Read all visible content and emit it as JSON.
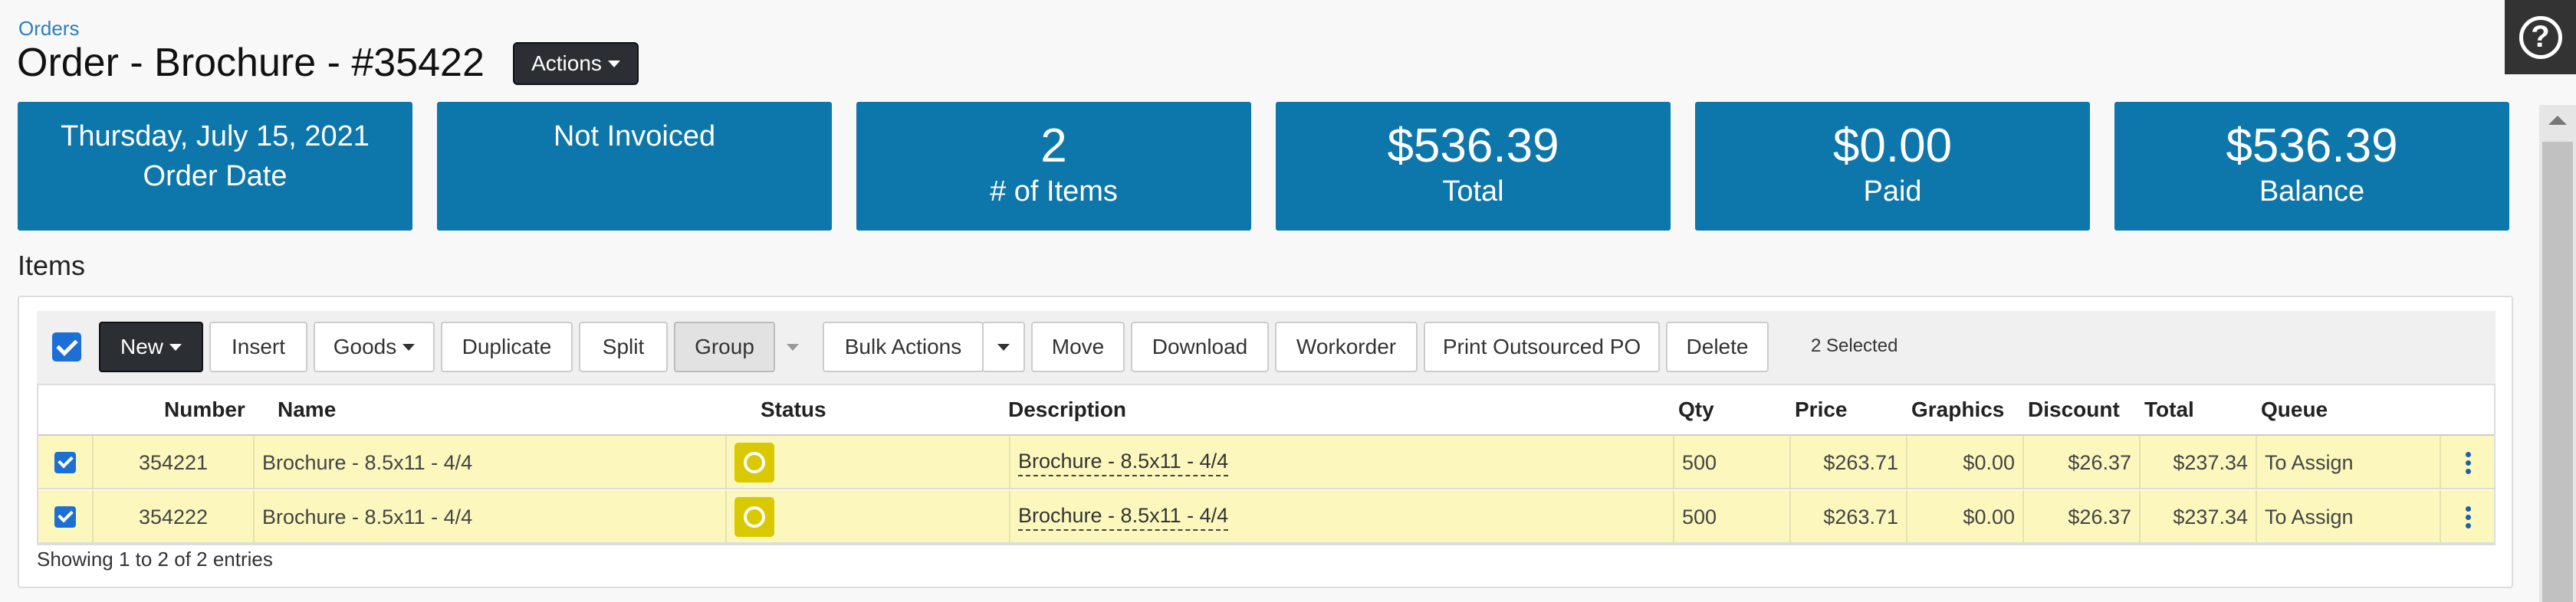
{
  "breadcrumb": "Orders",
  "title": "Order - Brochure - #35422",
  "actions_label": "Actions",
  "cards": {
    "order_date": {
      "value": "Thursday, July 15, 2021",
      "label": "Order Date"
    },
    "invoice": {
      "value": "Not Invoiced"
    },
    "items": {
      "value": "2",
      "label": "# of Items"
    },
    "total": {
      "value": "$536.39",
      "label": "Total"
    },
    "paid": {
      "value": "$0.00",
      "label": "Paid"
    },
    "balance": {
      "value": "$536.39",
      "label": "Balance"
    }
  },
  "items_heading": "Items",
  "toolbar": {
    "new": "New",
    "insert": "Insert",
    "goods": "Goods",
    "duplicate": "Duplicate",
    "split": "Split",
    "group": "Group",
    "bulk_actions": "Bulk Actions",
    "move": "Move",
    "download": "Download",
    "workorder": "Workorder",
    "print_po": "Print Outsourced PO",
    "delete": "Delete",
    "selected": "2 Selected"
  },
  "columns": {
    "number": "Number",
    "name": "Name",
    "status": "Status",
    "description": "Description",
    "qty": "Qty",
    "price": "Price",
    "graphics": "Graphics",
    "discount": "Discount",
    "total": "Total",
    "queue": "Queue"
  },
  "rows": [
    {
      "number": "354221",
      "name": "Brochure - 8.5x11 - 4/4",
      "description": "Brochure - 8.5x11 - 4/4",
      "qty": "500",
      "price": "$263.71",
      "graphics": "$0.00",
      "discount": "$26.37",
      "total": "$237.34",
      "queue": "To Assign"
    },
    {
      "number": "354222",
      "name": "Brochure - 8.5x11 - 4/4",
      "description": "Brochure - 8.5x11 - 4/4",
      "qty": "500",
      "price": "$263.71",
      "graphics": "$0.00",
      "discount": "$26.37",
      "total": "$237.34",
      "queue": "To Assign"
    }
  ],
  "footer": "Showing 1 to 2 of 2 entries",
  "colors": {
    "card_blue": "#0d76aa",
    "row_yellow": "#fcf8bd",
    "status_yellow": "#d8c900",
    "checkbox_blue": "#1d6fd6"
  }
}
